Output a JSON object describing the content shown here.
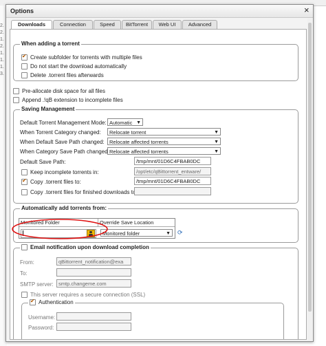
{
  "dialog": {
    "title": "Options",
    "close_glyph": "×"
  },
  "tabs": [
    "Downloads",
    "Connection",
    "Speed",
    "BitTorrent",
    "Web UI",
    "Advanced"
  ],
  "bg_numbers": [
    "2.",
    "2.",
    "1.",
    "2.",
    "1.",
    "1.",
    "1.",
    "3."
  ],
  "adding": {
    "legend": "When adding a torrent",
    "subfolder": "Create subfolder for torrents with multiple files",
    "nostart": "Do not start the download automatically",
    "delete": "Delete .torrent files afterwards"
  },
  "prealloc": "Pre-allocate disk space for all files",
  "append": "Append .!qB extension to incomplete files",
  "saving": {
    "legend": "Saving Management",
    "mode_label": "Default Torrent Management Mode:",
    "mode_value": "Automatic",
    "cat_changed_label": "When Torrent Category changed:",
    "cat_changed_value": "Relocate torrent",
    "def_path_changed_label": "When Default Save Path changed:",
    "def_path_changed_value": "Relocate affected torrents",
    "cat_path_changed_label": "When Category Save Path changed:",
    "cat_path_changed_value": "Relocate affected torrents",
    "def_save_label": "Default Save Path:",
    "def_save_value": "/tmp/mnt/01D6C4FBAB0DC",
    "keep_incomplete_label": "Keep incomplete torrents in:",
    "keep_incomplete_value": "/opt/etc/qBittorrent_entware/",
    "copy_label": "Copy .torrent files to:",
    "copy_value": "/tmp/mnt/01D6C4FBAB0DC",
    "copy_finished_label": "Copy .torrent files for finished downloads to:"
  },
  "autoadd": {
    "legend": "Automatically add torrents from:",
    "col_monitored": "Monitored Folder",
    "col_override": "Override Save Location",
    "override_value": "Monitored folder"
  },
  "email": {
    "legend": "Email notification upon download completion",
    "from_label": "From:",
    "from_value": "qBittorrent_notification@exa",
    "to_label": "To:",
    "smtp_label": "SMTP server:",
    "smtp_value": "smtp.changeme.com",
    "ssl_label": "This server requires a secure connection (SSL)",
    "auth_legend": "Authentication",
    "username_label": "Username:",
    "password_label": "Password:"
  },
  "colors": {
    "accent_check": "#b35a00",
    "annotation_red": "#e01010",
    "folder_icon": "#f0b800"
  }
}
